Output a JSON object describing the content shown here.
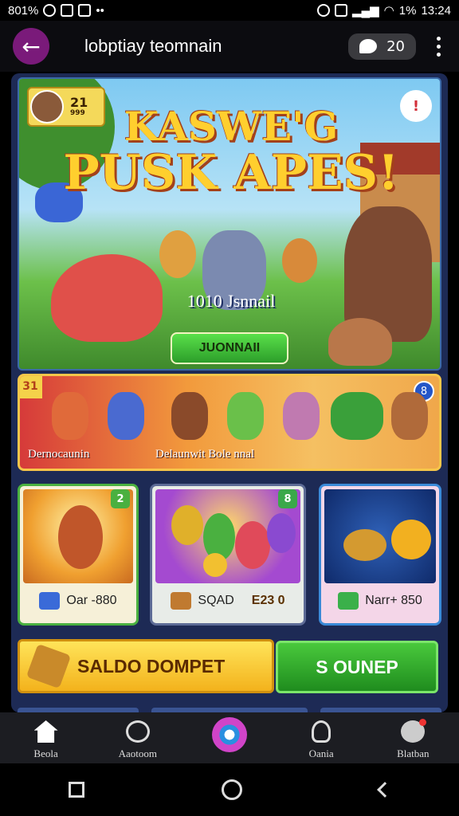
{
  "status_bar": {
    "left_text": "801%",
    "time": "13:24",
    "battery_text": "1%"
  },
  "header": {
    "title": "lobptiay teomnain",
    "chat_count": "20"
  },
  "hero": {
    "level_number": "21",
    "level_tag": "999",
    "title_line1": "KASWE'G",
    "title_line2": "PUSK APES!",
    "subtitle": "1010 Jsnnail",
    "button_label": "JUONNAII",
    "alert_glyph": "!"
  },
  "event_banner": {
    "corner_label": "31",
    "badge": "8",
    "label_left": "Dernocaunin",
    "label_right": "Delaunwit Bole nnal"
  },
  "cards": [
    {
      "badge": "2",
      "footer": "Oar -880"
    },
    {
      "badge": "8",
      "footer_left": "SQAD",
      "footer_right": "E23 0"
    },
    {
      "footer": "Narr+ 850"
    }
  ],
  "actions": {
    "wallet_label": "SALDO DOMPET",
    "open_label": "S OUNEP"
  },
  "bottom_nav": [
    {
      "label": "Beola",
      "icon": "home-icon"
    },
    {
      "label": "Aaotoom",
      "icon": "activity-icon"
    },
    {
      "label": "",
      "icon": "center-game-icon"
    },
    {
      "label": "Oania",
      "icon": "profile-icon"
    },
    {
      "label": "Blatban",
      "icon": "message-icon"
    }
  ],
  "colors": {
    "accent_purple": "#7a1a7a",
    "panel_blue": "#1d2a55",
    "wallet_yellow": "#f3b21c",
    "open_green": "#1f8c1e"
  }
}
